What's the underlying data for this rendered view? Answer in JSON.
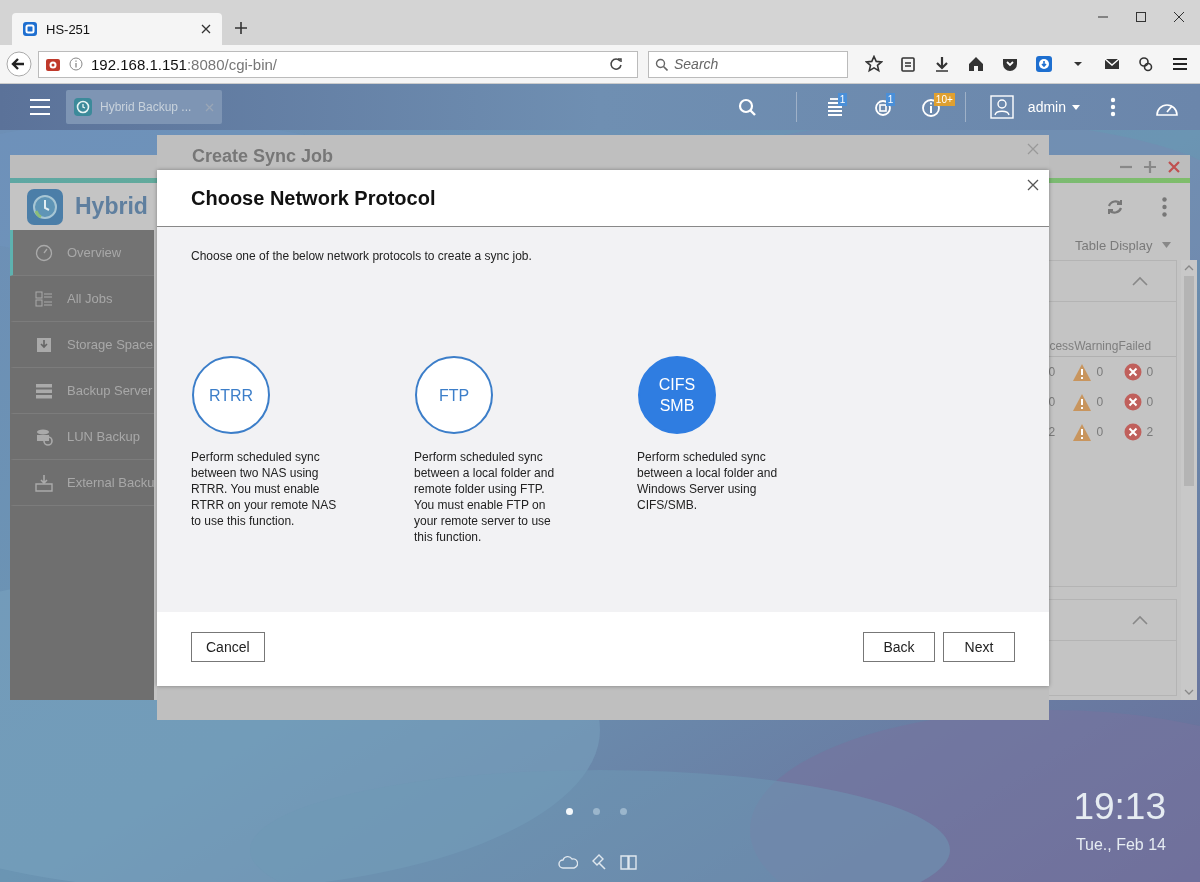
{
  "browser": {
    "tab": {
      "title": "HS-251",
      "selected": true
    },
    "address": {
      "host": "192.168.1.151",
      "path": ":8080/cgi-bin/"
    },
    "search": {
      "placeholder": "Search"
    }
  },
  "topbar": {
    "app_tab": "Hybrid Backup ...",
    "badges": [
      {
        "kind": "tasks",
        "count": "1"
      },
      {
        "kind": "sync",
        "count": "1"
      },
      {
        "kind": "info",
        "count": "10+"
      }
    ],
    "user": "admin"
  },
  "app_window": {
    "title": "Hybrid",
    "sidebar": [
      {
        "label": "Overview",
        "selected": true
      },
      {
        "label": "All Jobs",
        "selected": false
      },
      {
        "label": "Storage Space",
        "selected": false
      },
      {
        "label": "Backup Server",
        "selected": false
      },
      {
        "label": "LUN Backup",
        "selected": false
      },
      {
        "label": "External Backu",
        "selected": false
      }
    ],
    "view_selector": "Table Display",
    "table": {
      "columns": [
        "cess",
        "Warning",
        "Failed"
      ],
      "rows": [
        {
          "success": "0",
          "warning": "0",
          "failed": "0"
        },
        {
          "success": "0",
          "warning": "0",
          "failed": "0"
        },
        {
          "success": "2",
          "warning": "0",
          "failed": "2"
        }
      ]
    }
  },
  "back_dialog": {
    "title": "Create Sync Job"
  },
  "dialog": {
    "title": "Choose Network Protocol",
    "intro": "Choose one of the below network protocols to create a sync job.",
    "options": [
      {
        "label": "RTRR",
        "description": "Perform scheduled sync between two NAS using RTRR. You must enable RTRR on your remote NAS to use this function.",
        "selected": false
      },
      {
        "label": "FTP",
        "description": "Perform scheduled sync between a local folder and remote folder using FTP. You must enable FTP on your remote server to use this function.",
        "selected": false
      },
      {
        "label": "CIFS SMB",
        "description": "Perform scheduled sync between a local folder and Windows Server using CIFS/SMB.",
        "selected": true
      }
    ],
    "buttons": {
      "cancel": "Cancel",
      "back": "Back",
      "next": "Next"
    }
  },
  "desktop": {
    "pages": [
      {
        "selected": true
      },
      {
        "selected": false
      },
      {
        "selected": false
      }
    ],
    "time": "19:13",
    "date": "Tue., Feb 14"
  }
}
